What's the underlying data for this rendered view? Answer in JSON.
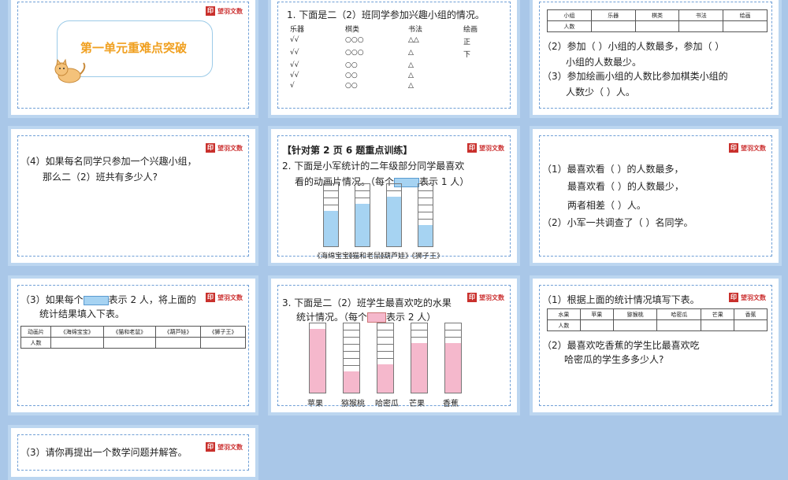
{
  "logo_text": "望羽文数",
  "s1": {
    "title": "第一单元重难点突破",
    "cat": "cat-icon"
  },
  "s2": {
    "q": "1. 下面是二（2）班同学参加兴趣小组的情况。",
    "headers": [
      "乐器",
      "棋类",
      "书法",
      "绘画"
    ],
    "rows": [
      [
        "√√",
        "○○○",
        "△△",
        "正"
      ],
      [
        "√√",
        "○○○",
        "△",
        "下"
      ],
      [
        "√√",
        "○○",
        "△",
        ""
      ],
      [
        "√√",
        "○○",
        "△",
        ""
      ],
      [
        "√",
        "○○",
        "△",
        ""
      ]
    ]
  },
  "s3": {
    "headers": [
      "小组",
      "乐器",
      "棋类",
      "书法",
      "绘画"
    ],
    "row_label": "人数",
    "l1": "（2）参加（      ）小组的人数最多，参加（      ）",
    "l2": "小组的人数最少。",
    "l3": "（3）参加绘画小组的人数比参加棋类小组的",
    "l4": "人数少（    ）人。"
  },
  "s4": {
    "l1": "（4）如果每名同学只参加一个兴趣小组，",
    "l2": "那么二（2）班共有多少人?"
  },
  "s5": {
    "head": "【针对第 2 页 6 题重点训练】",
    "l1": "2. 下面是小军统计的二年级部分同学最喜欢",
    "l2a": "看的动画片情况。（每个",
    "l2b": "表示 1 人）",
    "cats": [
      "《海绵宝宝》",
      "《猫和老鼠》",
      "《葫芦娃》",
      "《狮子王》"
    ],
    "values": [
      5,
      6,
      7,
      3
    ],
    "max": 9
  },
  "s6": {
    "l1": "（1）最喜欢看（                ）的人数最多，",
    "l2": "最喜欢看（                ）的人数最少，",
    "l3": "两者相差（     ）人。",
    "l4": "（2）小军一共调查了（       ）名同学。"
  },
  "s7": {
    "l1a": "（3）如果每个",
    "l1b": "表示 2 人，将上面的",
    "l2": "统计结果填入下表。",
    "headers": [
      "动画片",
      "《海绵宝宝》",
      "《猫和老鼠》",
      "《葫芦娃》",
      "《狮子王》"
    ],
    "row_label": "人数"
  },
  "s8": {
    "l1": "3. 下面是二（2）班学生最喜欢吃的水果",
    "l2a": "统计情况。（每个",
    "l2b": "表示 2 人）",
    "cats": [
      "苹果",
      "猕猴桃",
      "哈密瓜",
      "芒果",
      "香蕉"
    ],
    "values": [
      9,
      3,
      4,
      7,
      7
    ],
    "max": 10
  },
  "s9": {
    "l1": "（1）根据上面的统计情况填写下表。",
    "headers": [
      "水果",
      "苹果",
      "猕猴桃",
      "哈密瓜",
      "芒果",
      "香蕉"
    ],
    "row_label": "人数",
    "l2": "（2）最喜欢吃香蕉的学生比最喜欢吃",
    "l3": "哈密瓜的学生多多少人?"
  },
  "s10": {
    "l1": "（3）请你再提出一个数学问题并解答。"
  }
}
